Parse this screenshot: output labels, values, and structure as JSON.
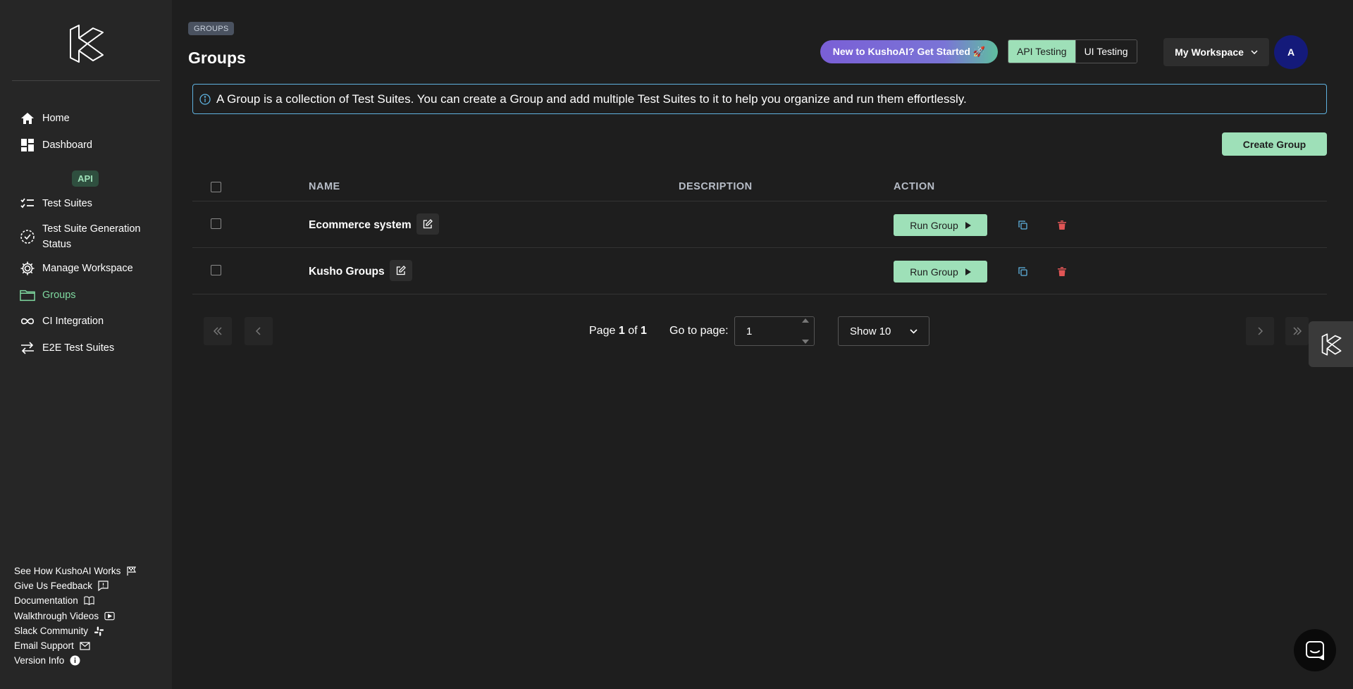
{
  "sidebar": {
    "section_badge": "API",
    "items": [
      {
        "label": "Home",
        "icon": "home-icon"
      },
      {
        "label": "Dashboard",
        "icon": "dashboard-icon"
      },
      {
        "label": "Test Suites",
        "icon": "checklist-icon"
      },
      {
        "label": "Test Suite Generation Status",
        "icon": "status-check-icon"
      },
      {
        "label": "Manage Workspace",
        "icon": "gear-icon"
      },
      {
        "label": "Groups",
        "icon": "folder-icon",
        "active": true
      },
      {
        "label": "CI Integration",
        "icon": "infinity-icon"
      },
      {
        "label": "E2E Test Suites",
        "icon": "arrows-icon"
      }
    ],
    "footer": [
      {
        "label": "See How KushoAI Works",
        "icon": "flag-icon"
      },
      {
        "label": "Give Us Feedback",
        "icon": "feedback-icon"
      },
      {
        "label": "Documentation",
        "icon": "book-icon"
      },
      {
        "label": "Walkthrough Videos",
        "icon": "video-icon"
      },
      {
        "label": "Slack Community",
        "icon": "slack-icon"
      },
      {
        "label": "Email Support",
        "icon": "mail-icon"
      },
      {
        "label": "Version Info",
        "icon": "info-icon"
      }
    ]
  },
  "header": {
    "breadcrumb": "GROUPS",
    "title": "Groups",
    "promo": "New to KushoAI? Get Started 🚀",
    "mode_tabs": [
      "API Testing",
      "UI Testing"
    ],
    "active_mode": "API Testing",
    "workspace": "My Workspace",
    "avatar_initial": "A"
  },
  "info_banner": "A Group is a collection of Test Suites. You can create a Group and add multiple Test Suites to it to help you organize and run them effortlessly.",
  "create_button": "Create Group",
  "table": {
    "columns": [
      "NAME",
      "DESCRIPTION",
      "ACTION"
    ],
    "rows": [
      {
        "name": "Ecommerce system",
        "description": "",
        "action": "Run Group"
      },
      {
        "name": "Kusho Groups",
        "description": "",
        "action": "Run Group"
      }
    ]
  },
  "pagination": {
    "page_prefix": "Page",
    "current_page": "1",
    "of_text": "of",
    "total_pages": "1",
    "goto_label": "Go to page:",
    "goto_value": "1",
    "page_size": "Show 10"
  },
  "colors": {
    "accent": "#9ee0b8",
    "info_border": "#5fb3e0",
    "delete": "#e05555",
    "avatar": "#141a7a"
  }
}
